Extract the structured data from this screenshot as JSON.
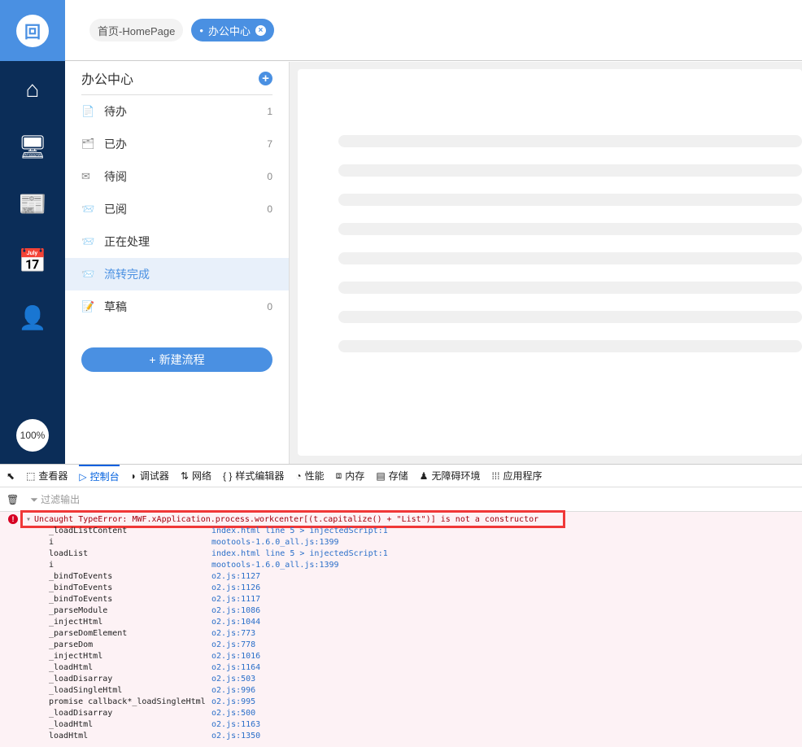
{
  "sidebar": {
    "zoom": "100%",
    "items": [
      "home",
      "desktop",
      "news",
      "calendar",
      "user-settings"
    ]
  },
  "tabs": [
    {
      "label": "首页-HomePage"
    },
    {
      "label": "办公中心",
      "dot": "•",
      "close": "×"
    }
  ],
  "menu": {
    "title": "办公中心",
    "add": "+",
    "items": [
      {
        "label": "待办",
        "count": "1",
        "icon": "📄"
      },
      {
        "label": "已办",
        "count": "7",
        "icon": "🗂"
      },
      {
        "label": "待阅",
        "count": "0",
        "icon": "✉"
      },
      {
        "label": "已阅",
        "count": "0",
        "icon": "📨"
      },
      {
        "label": "正在处理",
        "count": "",
        "icon": "📨"
      },
      {
        "label": "流转完成",
        "count": "",
        "icon": "📨"
      },
      {
        "label": "草稿",
        "count": "0",
        "icon": "📝"
      }
    ],
    "new_button": "新建流程",
    "new_icon": "+"
  },
  "devtools": {
    "tabs": [
      "查看器",
      "控制台",
      "调试器",
      "网络",
      "样式编辑器",
      "性能",
      "内存",
      "存储",
      "无障碍环境",
      "应用程序"
    ],
    "tab_icons": [
      "⬚",
      "▷",
      "◗",
      "⇅",
      "{ }",
      "◔",
      "⧈",
      "▤",
      "♟",
      "⁞⁞⁞"
    ],
    "filter_placeholder": "过滤输出",
    "error": "Uncaught TypeError: MWF.xApplication.process.workcenter[(t.capitalize() + \"List\")] is not a constructor",
    "stack": [
      [
        "_loadListContent",
        "index.html line 5 > injectedScript:1"
      ],
      [
        "i",
        "mootools-1.6.0_all.js:1399"
      ],
      [
        "loadList",
        "index.html line 5 > injectedScript:1"
      ],
      [
        "i",
        "mootools-1.6.0_all.js:1399"
      ],
      [
        "_bindToEvents",
        "o2.js:1127"
      ],
      [
        "_bindToEvents",
        "o2.js:1126"
      ],
      [
        "_bindToEvents",
        "o2.js:1117"
      ],
      [
        "_parseModule",
        "o2.js:1086"
      ],
      [
        "_injectHtml",
        "o2.js:1044"
      ],
      [
        "_parseDomElement",
        "o2.js:773"
      ],
      [
        "_parseDom",
        "o2.js:778"
      ],
      [
        "_injectHtml",
        "o2.js:1016"
      ],
      [
        "_loadHtml",
        "o2.js:1164"
      ],
      [
        "_loadDisarray",
        "o2.js:503"
      ],
      [
        "_loadSingleHtml",
        "o2.js:996"
      ],
      [
        "promise callback*_loadSingleHtml",
        "o2.js:995"
      ],
      [
        "_loadDisarray",
        "o2.js:500"
      ],
      [
        "_loadHtml",
        "o2.js:1163"
      ],
      [
        "loadHtml",
        "o2.js:1350"
      ]
    ]
  }
}
